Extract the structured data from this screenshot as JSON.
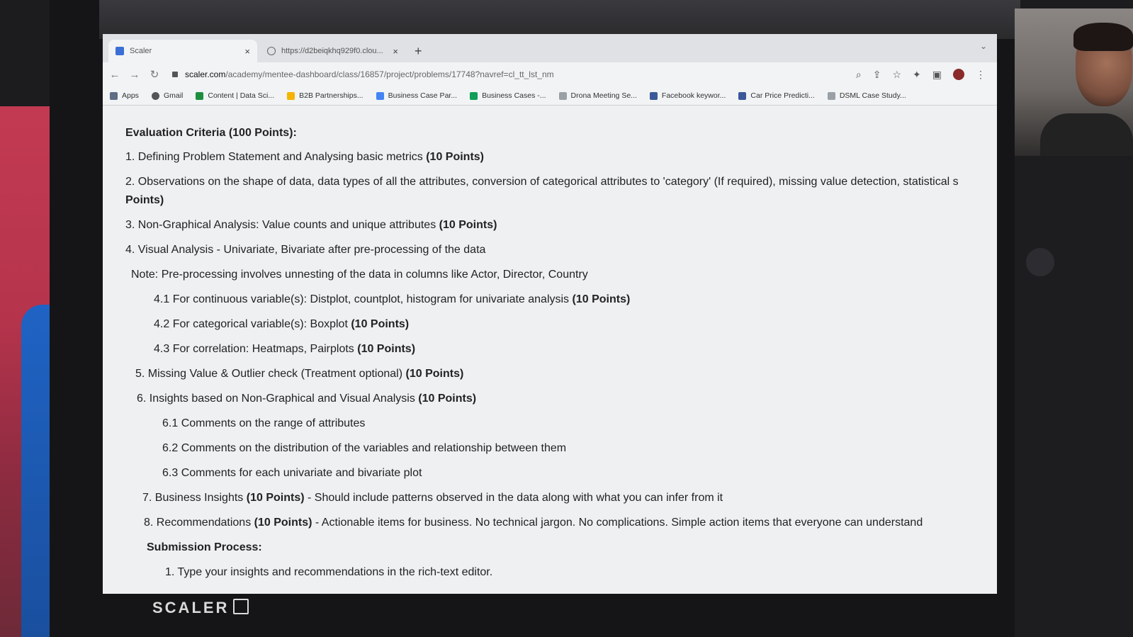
{
  "browser": {
    "tabs": [
      {
        "title": "Scaler"
      },
      {
        "title": "https://d2beiqkhq929f0.clou..."
      }
    ],
    "url_host": "scaler.com",
    "url_path": "/academy/mentee-dashboard/class/16857/project/problems/17748?navref=cl_tt_lst_nm",
    "bookmarks": [
      "Apps",
      "Gmail",
      "Content | Data Sci...",
      "B2B Partnerships...",
      "Business Case Par...",
      "Business Cases -...",
      "Drona Meeting Se...",
      "Facebook keywor...",
      "Car Price Predicti...",
      "DSML Case Study..."
    ]
  },
  "page": {
    "heading": "Evaluation Criteria (100 Points):",
    "items": [
      {
        "text": "1. Defining Problem Statement and Analysing basic metrics ",
        "points": "(10 Points)"
      },
      {
        "text": "2. Observations on the shape of data, data types of all the attributes, conversion of categorical attributes to 'category' (If required), missing value detection, statistical s",
        "points": ""
      },
      {
        "text": "",
        "points": "Points)"
      },
      {
        "text": "3. Non-Graphical Analysis: Value counts and unique attributes ",
        "points": "(10 Points)"
      },
      {
        "text": "4. Visual Analysis - Univariate, Bivariate after pre-processing of the data",
        "points": ""
      },
      {
        "text": "Note: Pre-processing involves unnesting of the data in columns like Actor, Director, Country",
        "points": ""
      },
      {
        "text": "4.1 For continuous variable(s): Distplot, countplot, histogram for univariate analysis ",
        "points": "(10 Points)"
      },
      {
        "text": "4.2 For categorical variable(s): Boxplot ",
        "points": "(10 Points)"
      },
      {
        "text": "4.3 For correlation: Heatmaps, Pairplots ",
        "points": "(10 Points)"
      },
      {
        "text": "5. Missing Value & Outlier check (Treatment optional) ",
        "points": "(10 Points)"
      },
      {
        "text": "6. Insights based on Non-Graphical and Visual Analysis ",
        "points": "(10 Points)"
      },
      {
        "text": "6.1 Comments on the range of attributes",
        "points": ""
      },
      {
        "text": "6.2 Comments on the distribution of the variables and relationship between them",
        "points": ""
      },
      {
        "text": "6.3 Comments for each univariate and bivariate plot",
        "points": ""
      }
    ],
    "item7": {
      "pre": "7. Business Insights ",
      "points": "(10 Points)",
      "post": " - Should include patterns observed in the data along with what you can infer from it"
    },
    "item8": {
      "pre": "8. Recommendations ",
      "points": "(10 Points)",
      "post": " - Actionable items for business. No technical jargon. No complications. Simple action items that everyone can understand"
    },
    "submission_heading": "Submission Process:",
    "submission_items": [
      "1. Type your insights and recommendations in the rich-text editor."
    ]
  },
  "brand": "SCALER"
}
